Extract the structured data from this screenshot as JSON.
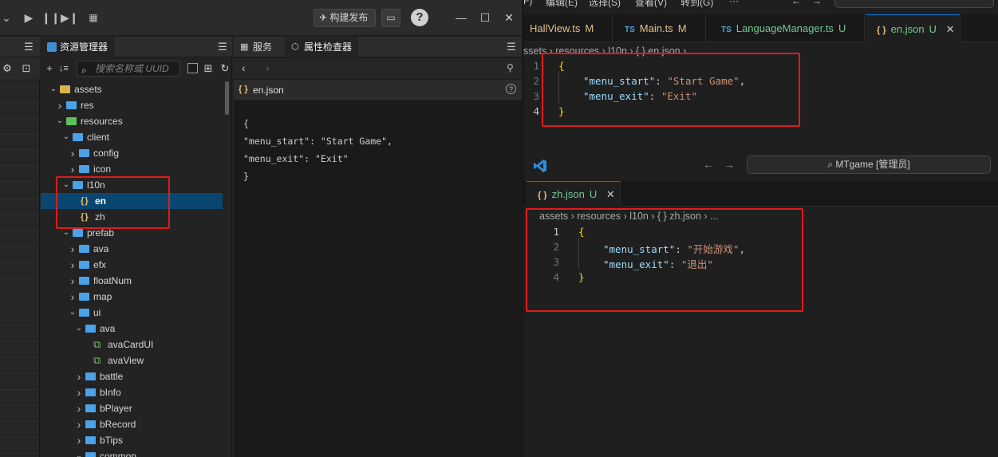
{
  "cocos": {
    "build_label": "构建发布",
    "help_label": "?",
    "assets_tab": "资源管理器",
    "services_tab": "服务",
    "inspector_tab": "属性检查器",
    "search_placeholder": "搜索名称或 UUID",
    "inspector_file": "en.json",
    "inspector_json_icon": "{ }",
    "inspector_lines": [
      "{",
      "\"menu_start\": \"Start Game\",",
      "\"menu_exit\": \"Exit\"",
      "}"
    ],
    "tree": [
      {
        "label": "assets",
        "depth": 0,
        "arrow": "down",
        "icon": "db"
      },
      {
        "label": "res",
        "depth": 1,
        "arrow": "right",
        "icon": "folder"
      },
      {
        "label": "resources",
        "depth": 1,
        "arrow": "down",
        "icon": "folder-green"
      },
      {
        "label": "client",
        "depth": 2,
        "arrow": "down",
        "icon": "folder-open"
      },
      {
        "label": "config",
        "depth": 3,
        "arrow": "right",
        "icon": "folder"
      },
      {
        "label": "icon",
        "depth": 3,
        "arrow": "right",
        "icon": "folder"
      },
      {
        "label": "l10n",
        "depth": 2,
        "arrow": "down",
        "icon": "folder-open"
      },
      {
        "label": "en",
        "depth": 3,
        "arrow": "none",
        "icon": "json",
        "selected": true
      },
      {
        "label": "zh",
        "depth": 3,
        "arrow": "none",
        "icon": "json"
      },
      {
        "label": "prefab",
        "depth": 2,
        "arrow": "down",
        "icon": "folder-open"
      },
      {
        "label": "ava",
        "depth": 3,
        "arrow": "right",
        "icon": "folder"
      },
      {
        "label": "efx",
        "depth": 3,
        "arrow": "right",
        "icon": "folder"
      },
      {
        "label": "floatNum",
        "depth": 3,
        "arrow": "right",
        "icon": "folder"
      },
      {
        "label": "map",
        "depth": 3,
        "arrow": "right",
        "icon": "folder"
      },
      {
        "label": "ui",
        "depth": 3,
        "arrow": "down",
        "icon": "folder-open"
      },
      {
        "label": "ava",
        "depth": 4,
        "arrow": "down",
        "icon": "folder-open"
      },
      {
        "label": "avaCardUI",
        "depth": 5,
        "arrow": "none",
        "icon": "prefab"
      },
      {
        "label": "avaView",
        "depth": 5,
        "arrow": "none",
        "icon": "prefab"
      },
      {
        "label": "battle",
        "depth": 4,
        "arrow": "right",
        "icon": "folder"
      },
      {
        "label": "bInfo",
        "depth": 4,
        "arrow": "right",
        "icon": "folder"
      },
      {
        "label": "bPlayer",
        "depth": 4,
        "arrow": "right",
        "icon": "folder"
      },
      {
        "label": "bRecord",
        "depth": 4,
        "arrow": "right",
        "icon": "folder"
      },
      {
        "label": "bTips",
        "depth": 4,
        "arrow": "right",
        "icon": "folder"
      },
      {
        "label": "common",
        "depth": 4,
        "arrow": "down",
        "icon": "folder-open"
      }
    ]
  },
  "vscode": {
    "menu": [
      "编辑(E)",
      "选择(S)",
      "查看(V)",
      "转到(G)",
      "···"
    ],
    "tabs": [
      {
        "label": "HallView.ts",
        "badge": "TS",
        "status": "M"
      },
      {
        "label": "Main.ts",
        "badge": "TS",
        "status": "M"
      },
      {
        "label": "LanguageManager.ts",
        "badge": "TS",
        "status": "U"
      },
      {
        "label": "en.json",
        "badge": "{ }",
        "status": "U",
        "active": true
      }
    ],
    "close_glyph": "✕",
    "breadcrumb_en": [
      "ssets",
      "resources",
      "l10n",
      "{ } en.json",
      "..."
    ],
    "en_code": [
      {
        "num": "1",
        "text": "{"
      },
      {
        "num": "2",
        "key": "\"menu_start\"",
        "val": "\"Start Game\"",
        "comma": ","
      },
      {
        "num": "3",
        "key": "\"menu_exit\"",
        "val": "\"Exit\"",
        "comma": ""
      },
      {
        "num": "4",
        "text": "}"
      }
    ],
    "second_window": {
      "search_label": "MTgame [管理员]",
      "tab_label": "zh.json",
      "tab_status": "U",
      "tab_badge": "{ }",
      "breadcrumb": [
        "assets",
        "resources",
        "l10n",
        "{ } zh.json",
        "..."
      ],
      "code": [
        {
          "num": "1",
          "text": "{"
        },
        {
          "num": "2",
          "key": "\"menu_start\"",
          "val": "\"开始游戏\"",
          "comma": ","
        },
        {
          "num": "3",
          "key": "\"menu_exit\"",
          "val": "\"退出\"",
          "comma": ""
        },
        {
          "num": "4",
          "text": "}"
        }
      ]
    }
  },
  "colors": {
    "highlight_box": "#e01b1b",
    "selection": "#094771",
    "vs_accent": "#0078d4"
  }
}
